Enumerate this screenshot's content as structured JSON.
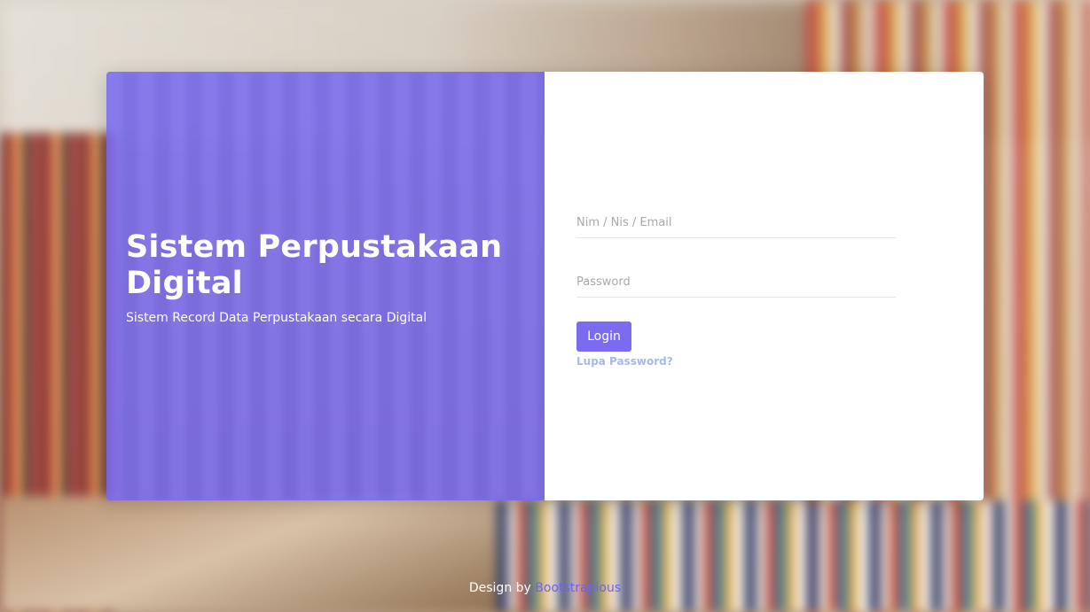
{
  "hero": {
    "title": "Sistem Perpustakaan Digital",
    "subtitle": "Sistem Record Data Perpustakaan secara Digital"
  },
  "login_form": {
    "username_placeholder": "Nim / Nis / Email",
    "username_value": "",
    "password_placeholder": "Password",
    "password_value": "",
    "submit_label": "Login",
    "forgot_label": "Lupa Password?"
  },
  "footer": {
    "prefix": "Design by",
    "credit_link": "Bootstrapious"
  },
  "colors": {
    "accent": "#7a6cf0",
    "hero_panel": "#7264f0",
    "link": "#a8b8e8"
  }
}
